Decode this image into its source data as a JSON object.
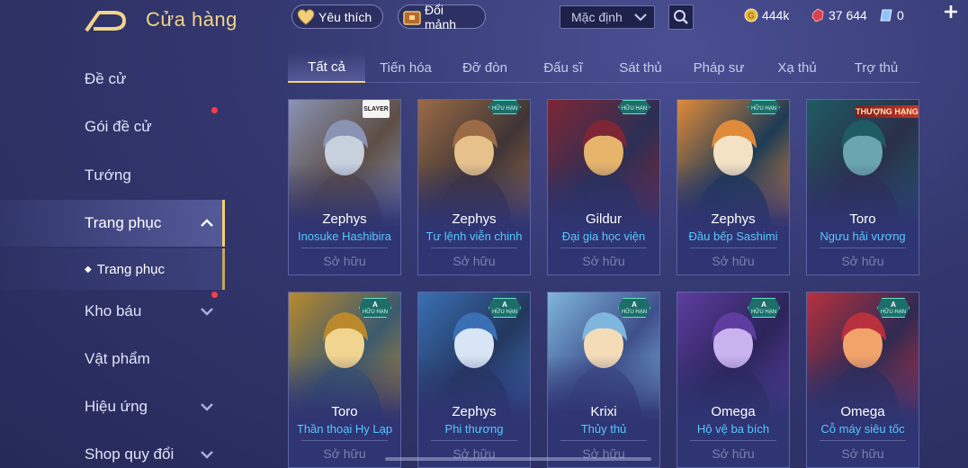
{
  "header": {
    "title": "Cửa hàng",
    "favorite_label": "Yêu thích",
    "shard_label": "Đổi mảnh",
    "sort_value": "Mặc định",
    "gold": "444k",
    "gems": "37 644",
    "vouchers": "0"
  },
  "sidebar": {
    "items": [
      {
        "label": "Đề cử",
        "has_dot": false,
        "chevron": "none"
      },
      {
        "label": "Gói đề cử",
        "has_dot": true,
        "chevron": "none"
      },
      {
        "label": "Tướng",
        "has_dot": false,
        "chevron": "none"
      },
      {
        "label": "Trang phục",
        "has_dot": false,
        "chevron": "up",
        "active": true
      },
      {
        "label": "Kho báu",
        "has_dot": true,
        "chevron": "down"
      },
      {
        "label": "Vật phẩm",
        "has_dot": false,
        "chevron": "none"
      },
      {
        "label": "Hiệu ứng",
        "has_dot": false,
        "chevron": "down"
      },
      {
        "label": "Shop quy đổi",
        "has_dot": false,
        "chevron": "down"
      }
    ],
    "sub_item": "Trang phục"
  },
  "tabs": [
    "Tất cả",
    "Tiến hóa",
    "Đỡ đòn",
    "Đấu sĩ",
    "Sát thủ",
    "Pháp sư",
    "Xạ thủ",
    "Trợ thủ"
  ],
  "cards": [
    {
      "hero": "Zephys",
      "skin": "Inosuke Hashibira",
      "status": "Sở hữu",
      "badge": "logo",
      "logo_text": "SLAYER",
      "colors": [
        "#8a93b3",
        "#c7d0dd",
        "#5d4e45"
      ]
    },
    {
      "hero": "Zephys",
      "skin": "Tư lệnh viễn chinh",
      "status": "Sở hữu",
      "badge": "limited",
      "badge_text": "HỮU HẠN",
      "colors": [
        "#9a6b45",
        "#e6c18c",
        "#3f3436"
      ]
    },
    {
      "hero": "Gildur",
      "skin": "Đại gia học viện",
      "status": "Sở hữu",
      "badge": "limited",
      "badge_text": "HỮU HẠN",
      "colors": [
        "#7d2635",
        "#e7b46c",
        "#2b2f55"
      ]
    },
    {
      "hero": "Zephys",
      "skin": "Đầu bếp Sashimi",
      "status": "Sở hữu",
      "badge": "limited",
      "badge_text": "HỮU HẠN",
      "colors": [
        "#e08b3a",
        "#f3e2c3",
        "#1d3a55"
      ]
    },
    {
      "hero": "Toro",
      "skin": "Ngưu hải vương",
      "status": "Sở hữu",
      "badge": "ribbon",
      "ribbon_text": "THƯỢNG HẠNG",
      "colors": [
        "#1f5b63",
        "#6ba5b0",
        "#2a2f4a"
      ]
    },
    {
      "hero": "Toro",
      "skin": "Thần thoại Hy Lạp",
      "status": "Sở hữu",
      "badge": "rank",
      "rank": "A",
      "badge_text": "HỮU HẠN",
      "colors": [
        "#b9892c",
        "#f0d490",
        "#3b5a6e"
      ]
    },
    {
      "hero": "Zephys",
      "skin": "Phi thương",
      "status": "Sở hữu",
      "badge": "rank",
      "rank": "A",
      "badge_text": "HỮU HẠN",
      "colors": [
        "#3a6fb4",
        "#d8e5f5",
        "#23375e"
      ]
    },
    {
      "hero": "Krixi",
      "skin": "Thủy thủ",
      "status": "Sở hữu",
      "badge": "rank",
      "rank": "A",
      "badge_text": "HỮU HẠN",
      "colors": [
        "#7fb6dd",
        "#f4dcb8",
        "#3e4f8a"
      ]
    },
    {
      "hero": "Omega",
      "skin": "Hộ vệ ba bích",
      "status": "Sở hữu",
      "badge": "rank",
      "rank": "A",
      "badge_text": "HỮU HẠN",
      "colors": [
        "#5d3da0",
        "#c9b3ef",
        "#2b2459"
      ]
    },
    {
      "hero": "Omega",
      "skin": "Cỗ máy siêu tốc",
      "status": "Sở hữu",
      "badge": "rank",
      "rank": "A",
      "badge_text": "HỮU HẠN",
      "colors": [
        "#b8303d",
        "#f2a36a",
        "#2f2a52"
      ]
    }
  ],
  "colors": {
    "gold_accent": "#f1d48a",
    "skin_name": "#57c7ff",
    "owned": "#7b80b0",
    "dot": "#ff3a4a"
  }
}
